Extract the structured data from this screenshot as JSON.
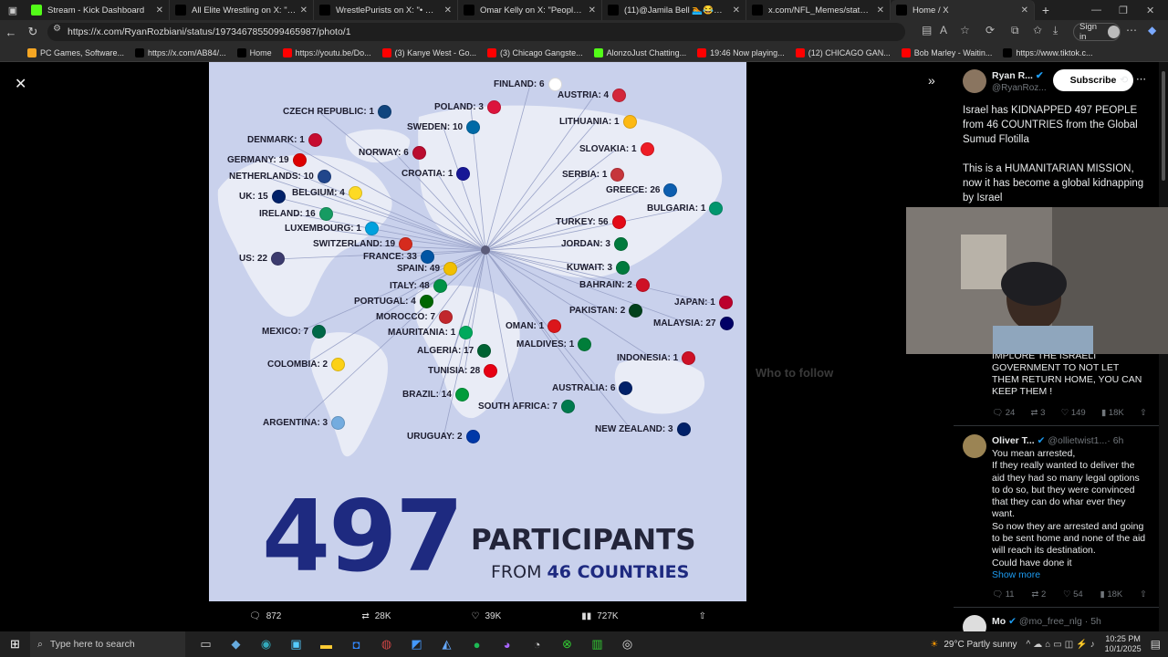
{
  "tabs": [
    {
      "title": "Stream - Kick Dashboard",
      "favcolor": "#53fc18"
    },
    {
      "title": "All Elite Wrestling on X: \"That's m",
      "favcolor": "#000000"
    },
    {
      "title": "WrestlePurists on X: \"• March 21s",
      "favcolor": "#000000"
    },
    {
      "title": "Omar Kelly on X: \"People on Elon",
      "favcolor": "#000000"
    },
    {
      "title": "(11)@Jamila Bell 🏊😂😂😂😂",
      "favcolor": "#000000"
    },
    {
      "title": "x.com/NFL_Memes/status/19730",
      "favcolor": "#000000"
    },
    {
      "title": "Home / X",
      "favcolor": "#000000"
    }
  ],
  "address": {
    "url": "https://x.com/RyanRozbiani/status/1973467855099465987/photo/1",
    "signin": "Sign in"
  },
  "bookmarks": [
    {
      "label": "PC Games, Software...",
      "color": "#f5a623"
    },
    {
      "label": "https://x.com/AB84/...",
      "color": "#000000"
    },
    {
      "label": "Home",
      "color": "#000000"
    },
    {
      "label": "https://youtu.be/Do...",
      "color": "#ff0000"
    },
    {
      "label": "(3) Kanye West - Go...",
      "color": "#ff0000"
    },
    {
      "label": "(3) Chicago Gangste...",
      "color": "#ff0000"
    },
    {
      "label": "AlonzoJust Chatting...",
      "color": "#53fc18"
    },
    {
      "label": "19:46 Now playing...",
      "color": "#ff0000"
    },
    {
      "label": "(12) CHICAGO GAN...",
      "color": "#ff0000"
    },
    {
      "label": "Bob Marley - Waitin...",
      "color": "#ff0000"
    },
    {
      "label": "https://www.tiktok.c...",
      "color": "#000000"
    }
  ],
  "infographic": {
    "total": "497",
    "participants": "PARTICIPANTS",
    "from": "FROM",
    "countries_count": "46 COUNTRIES",
    "countries": [
      {
        "label": "FINLAND: 6",
        "flag": "#ffffff"
      },
      {
        "label": "AUSTRIA: 4",
        "flag": "#d3263a"
      },
      {
        "label": "POLAND: 3",
        "flag": "#dc143c"
      },
      {
        "label": "CZECH REPUBLIC: 1",
        "flag": "#11457e"
      },
      {
        "label": "LITHUANIA: 1",
        "flag": "#fdb913"
      },
      {
        "label": "SWEDEN: 10",
        "flag": "#006aa7"
      },
      {
        "label": "DENMARK: 1",
        "flag": "#c60c30"
      },
      {
        "label": "NORWAY: 6",
        "flag": "#ba0c2f"
      },
      {
        "label": "SLOVAKIA: 1",
        "flag": "#ee1c25"
      },
      {
        "label": "GERMANY: 19",
        "flag": "#dd0000"
      },
      {
        "label": "CROATIA: 1",
        "flag": "#171796"
      },
      {
        "label": "SERBIA: 1",
        "flag": "#c6363c"
      },
      {
        "label": "NETHERLANDS: 10",
        "flag": "#21468b"
      },
      {
        "label": "GREECE: 26",
        "flag": "#0d5eaf"
      },
      {
        "label": "UK: 15",
        "flag": "#012169"
      },
      {
        "label": "BELGIUM: 4",
        "flag": "#fdda24"
      },
      {
        "label": "BULGARIA: 1",
        "flag": "#00966e"
      },
      {
        "label": "IRELAND: 16",
        "flag": "#169b62"
      },
      {
        "label": "TURKEY: 56",
        "flag": "#e30a17"
      },
      {
        "label": "LUXEMBOURG: 1",
        "flag": "#00a1de"
      },
      {
        "label": "SWITZERLAND: 19",
        "flag": "#d52b1e"
      },
      {
        "label": "JORDAN: 3",
        "flag": "#007a3d"
      },
      {
        "label": "FRANCE: 33",
        "flag": "#0055a4"
      },
      {
        "label": "US: 22",
        "flag": "#3c3b6e"
      },
      {
        "label": "SPAIN: 49",
        "flag": "#f1bf00"
      },
      {
        "label": "KUWAIT: 3",
        "flag": "#007a3d"
      },
      {
        "label": "ITALY: 48",
        "flag": "#009246"
      },
      {
        "label": "BAHRAIN: 2",
        "flag": "#ce1126"
      },
      {
        "label": "PORTUGAL: 4",
        "flag": "#006600"
      },
      {
        "label": "JAPAN: 1",
        "flag": "#bc002d"
      },
      {
        "label": "MOROCCO: 7",
        "flag": "#c1272d"
      },
      {
        "label": "PAKISTAN: 2",
        "flag": "#01411c"
      },
      {
        "label": "MEXICO: 7",
        "flag": "#006847"
      },
      {
        "label": "MAURITANIA: 1",
        "flag": "#00a95c"
      },
      {
        "label": "OMAN: 1",
        "flag": "#db161b"
      },
      {
        "label": "MALAYSIA: 27",
        "flag": "#010066"
      },
      {
        "label": "ALGERIA: 17",
        "flag": "#006233"
      },
      {
        "label": "MALDIVES: 1",
        "flag": "#007e3a"
      },
      {
        "label": "INDONESIA: 1",
        "flag": "#ce1126"
      },
      {
        "label": "COLOMBIA: 2",
        "flag": "#fcd116"
      },
      {
        "label": "TUNISIA: 28",
        "flag": "#e70013"
      },
      {
        "label": "AUSTRALIA: 6",
        "flag": "#012169"
      },
      {
        "label": "BRAZIL: 14",
        "flag": "#009c3b"
      },
      {
        "label": "SOUTH AFRICA: 7",
        "flag": "#007a4d"
      },
      {
        "label": "ARGENTINA: 3",
        "flag": "#74acdf"
      },
      {
        "label": "NEW ZEALAND: 3",
        "flag": "#012169"
      },
      {
        "label": "URUGUAY: 2",
        "flag": "#0038a8"
      }
    ]
  },
  "photo_actions": {
    "replies": "872",
    "reposts": "28K",
    "likes": "39K",
    "views": "727K"
  },
  "sidebar": {
    "author": {
      "name": "Ryan R...",
      "handle": "@RyanRoz...",
      "subscribe": "Subscribe"
    },
    "tweet_text": "Israel has KIDNAPPED 497 PEOPLE from 46 COUNTRIES from the Global Sumud Flotilla\n\nThis is a HUMANITARIAN MISSION, now it has become a global kidnapping by Israel",
    "reply1_text": "IMPLORE THE ISRAELI GOVERNMENT TO NOT LET THEM RETURN HOME, YOU CAN KEEP THEM !",
    "reply1_stats": {
      "replies": "24",
      "reposts": "3",
      "likes": "149",
      "views": "18K"
    },
    "reply2": {
      "name": "Oliver T...",
      "handle": "@ollietwist1...",
      "time": "· 6h",
      "text": "You mean arrested,\nIf they really wanted to deliver the aid they had so many legal options to do so, but they were convinced that they can do whar ever they want.\nSo now they are arrested and going to be sent home and none of the aid will reach its destination.\nCould have done it",
      "show_more": "Show more",
      "stats": {
        "replies": "11",
        "reposts": "2",
        "likes": "54",
        "views": "18K"
      }
    },
    "reply3": {
      "name": "Mo",
      "handle": "@mo_free_nlg",
      "time": "· 5h"
    }
  },
  "background_feed": {
    "who_to_follow": "Who to follow"
  },
  "taskbar": {
    "search": "Type here to search",
    "weather": "29°C  Partly sunny",
    "time": "10:25 PM",
    "date": "10/1/2025"
  }
}
